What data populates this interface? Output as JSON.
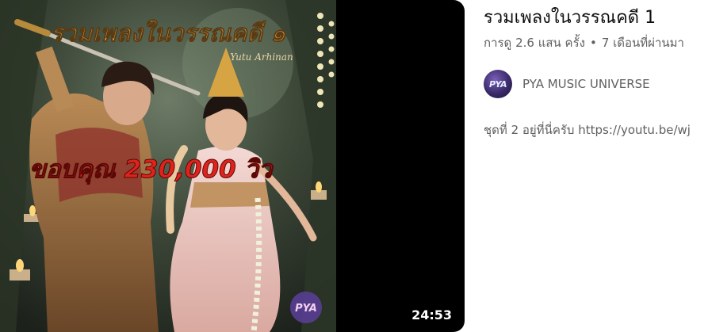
{
  "video": {
    "title": "รวมเพลงในวรรณคดี 1",
    "views": "การดู 2.6 แสน ครั้ง",
    "separator": "•",
    "uploaded": "7 เดือนที่ผ่านมา",
    "duration": "24:53",
    "channel": {
      "name": "PYA MUSIC UNIVERSE",
      "avatar_text": "PYA"
    },
    "description": "ชุดที่ 2 อยู่ที่นี่ครับ https://youtu.be/wj"
  },
  "thumbnail": {
    "overlay_title": "รวมเพลงในวรรณคดี ๑",
    "overlay_subtitle": "Yutu Arhinan",
    "overlay_caption": "ขอบคุณ 230,000 วิว",
    "watermark": "PYA",
    "colors": {
      "title_gold": "#d8a24a",
      "caption_red": "#e0221c",
      "background": "#000000"
    }
  }
}
